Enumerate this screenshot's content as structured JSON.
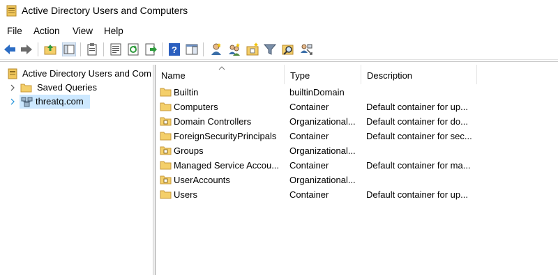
{
  "window": {
    "title": "Active Directory Users and Computers"
  },
  "menu": [
    "File",
    "Action",
    "View",
    "Help"
  ],
  "toolbar": {
    "buttons": [
      "back-arrow-icon",
      "forward-arrow-icon",
      "up-folder-icon",
      "show-console-tree-icon",
      "clipboard-icon",
      "properties-icon",
      "refresh-icon",
      "export-list-icon",
      "help-icon",
      "action-pane-icon",
      "new-user-icon",
      "new-group-icon",
      "new-ou-icon",
      "filter-icon",
      "find-icon",
      "delegate-icon"
    ]
  },
  "tree": {
    "root": "Active Directory Users and Com",
    "items": [
      {
        "label": "Saved Queries",
        "icon": "folder-icon"
      },
      {
        "label": "threatq.com",
        "icon": "domain-icon",
        "selected": true
      }
    ]
  },
  "list": {
    "columns": [
      "Name",
      "Type",
      "Description"
    ],
    "rows": [
      {
        "name": "Builtin",
        "type": "builtinDomain",
        "description": "",
        "icon": "folder-icon"
      },
      {
        "name": "Computers",
        "type": "Container",
        "description": "Default container for up...",
        "icon": "folder-icon"
      },
      {
        "name": "Domain Controllers",
        "type": "Organizational...",
        "description": "Default container for do...",
        "icon": "ou-icon"
      },
      {
        "name": "ForeignSecurityPrincipals",
        "type": "Container",
        "description": "Default container for sec...",
        "icon": "folder-icon"
      },
      {
        "name": "Groups",
        "type": "Organizational...",
        "description": "",
        "icon": "ou-icon"
      },
      {
        "name": "Managed Service Accou...",
        "type": "Container",
        "description": "Default container for ma...",
        "icon": "folder-icon"
      },
      {
        "name": "UserAccounts",
        "type": "Organizational...",
        "description": "",
        "icon": "ou-icon"
      },
      {
        "name": "Users",
        "type": "Container",
        "description": "Default container for up...",
        "icon": "folder-icon"
      }
    ]
  },
  "colors": {
    "selection": "#cce8ff",
    "folder": "#f4cf6a",
    "folder_dark": "#d8a63a",
    "toolbar_blue": "#2b6cc4"
  }
}
